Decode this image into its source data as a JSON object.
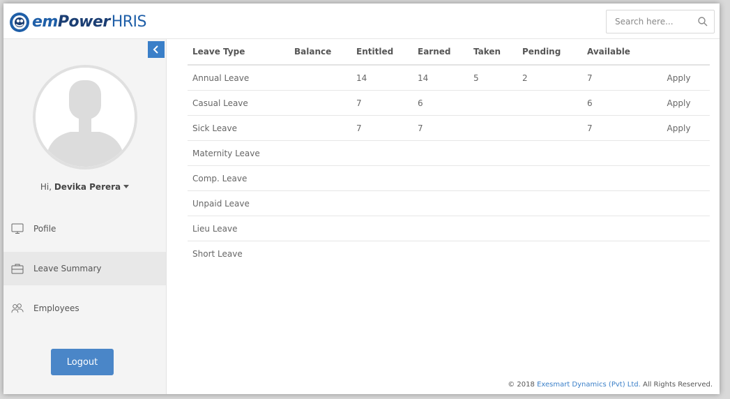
{
  "app": {
    "logo_em": "em",
    "logo_power": "Power",
    "logo_hris": "HRIS"
  },
  "search": {
    "placeholder": "Search here..."
  },
  "sidebar": {
    "greeting_prefix": "Hi, ",
    "user_name": "Devika Perera",
    "items": [
      {
        "label": "Pofile",
        "icon": "monitor-icon"
      },
      {
        "label": "Leave Summary",
        "icon": "briefcase-icon"
      },
      {
        "label": "Employees",
        "icon": "users-icon"
      }
    ],
    "logout_label": "Logout"
  },
  "table": {
    "headers": [
      "Leave Type",
      "Balance",
      "Entitled",
      "Earned",
      "Taken",
      "Pending",
      "Available",
      ""
    ],
    "rows": [
      {
        "type": "Annual Leave",
        "balance": "",
        "entitled": "14",
        "earned": "14",
        "taken": "5",
        "pending": "2",
        "available": "7",
        "action": "Apply"
      },
      {
        "type": "Casual Leave",
        "balance": "",
        "entitled": "7",
        "earned": "6",
        "taken": "",
        "pending": "",
        "available": "6",
        "action": "Apply"
      },
      {
        "type": "Sick Leave",
        "balance": "",
        "entitled": "7",
        "earned": "7",
        "taken": "",
        "pending": "",
        "available": "7",
        "action": "Apply"
      },
      {
        "type": "Maternity Leave",
        "balance": "",
        "entitled": "",
        "earned": "",
        "taken": "",
        "pending": "",
        "available": "",
        "action": ""
      },
      {
        "type": "Comp. Leave",
        "balance": "",
        "entitled": "",
        "earned": "",
        "taken": "",
        "pending": "",
        "available": "",
        "action": ""
      },
      {
        "type": "Unpaid Leave",
        "balance": "",
        "entitled": "",
        "earned": "",
        "taken": "",
        "pending": "",
        "available": "",
        "action": ""
      },
      {
        "type": "Lieu Leave",
        "balance": "",
        "entitled": "",
        "earned": "",
        "taken": "",
        "pending": "",
        "available": "",
        "action": ""
      },
      {
        "type": "Short Leave",
        "balance": "",
        "entitled": "",
        "earned": "",
        "taken": "",
        "pending": "",
        "available": "",
        "action": ""
      }
    ]
  },
  "footer": {
    "prefix": "© 2018 ",
    "company": "Exesmart Dynamics (Pvt) Ltd.",
    "suffix": " All Rights Reserved."
  },
  "colors": {
    "accent": "#3a7fc8",
    "logout_bg": "#4a86c8",
    "logo_dark": "#1b3e73"
  }
}
